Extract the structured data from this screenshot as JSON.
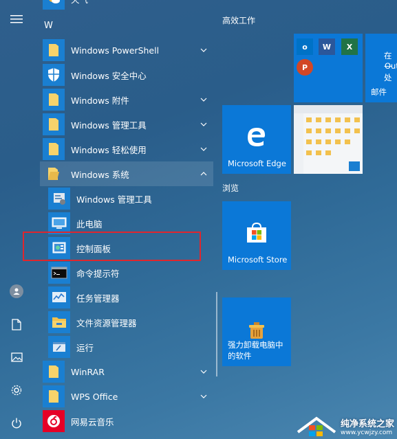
{
  "apps": {
    "top_partial": "天气",
    "letter": "W",
    "items": [
      {
        "label": "Windows PowerShell"
      },
      {
        "label": "Windows 安全中心"
      },
      {
        "label": "Windows 附件"
      },
      {
        "label": "Windows 管理工具"
      },
      {
        "label": "Windows 轻松使用"
      },
      {
        "label": "Windows 系统"
      },
      {
        "label": "Windows 管理工具"
      },
      {
        "label": "此电脑"
      },
      {
        "label": "控制面板"
      },
      {
        "label": "命令提示符"
      },
      {
        "label": "任务管理器"
      },
      {
        "label": "文件资源管理器"
      },
      {
        "label": "运行"
      },
      {
        "label": "WinRAR"
      },
      {
        "label": "WPS Office"
      },
      {
        "label": "网易云音乐"
      }
    ]
  },
  "tiles": {
    "group1_title": "高效工作",
    "group2_title": "浏览",
    "mail_partial_1": "在一处",
    "mail_partial_2": "Out",
    "mail_label": "邮件",
    "edge_label": "Microsoft Edge",
    "store_label": "Microsoft Store",
    "uninstaller_label_line1": "强力卸载电脑中",
    "uninstaller_label_line2": "的软件"
  },
  "watermark": {
    "title": "纯净系统之家",
    "url": "www.ycwjzy.com"
  },
  "colors": {
    "tile_blue": "#0b78d7",
    "highlight_red": "#e0262d",
    "folder_yellow": "#f7d36b"
  }
}
